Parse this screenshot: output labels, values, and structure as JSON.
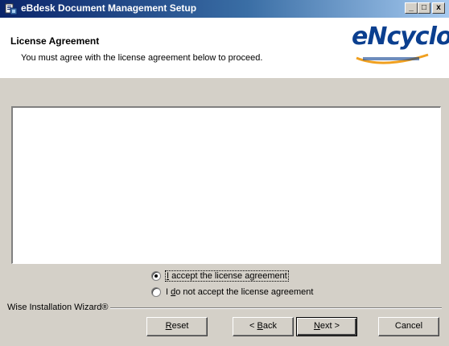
{
  "window": {
    "title": "eBdesk Document Management Setup",
    "controls": {
      "minimize": "_",
      "maximize": "□",
      "close": "x"
    }
  },
  "header": {
    "title": "License Agreement",
    "subtitle": "You must agree with the license agreement below to proceed.",
    "logo_text": "eNcyclo"
  },
  "license": {
    "text": ""
  },
  "options": {
    "accept": {
      "pre": "",
      "key": "I",
      "post": " accept the license agreement",
      "selected": true
    },
    "decline": {
      "pre": "I ",
      "key": "d",
      "post": "o not accept the license agreement",
      "selected": false
    }
  },
  "footer": {
    "brand": "Wise Installation Wizard®"
  },
  "buttons": {
    "reset": {
      "key": "R",
      "rest": "eset"
    },
    "back": {
      "pre": "< ",
      "key": "B",
      "rest": "ack"
    },
    "next": {
      "key": "N",
      "rest": "ext >"
    },
    "cancel": {
      "label": "Cancel"
    }
  },
  "colors": {
    "titlebar_start": "#0a246a",
    "titlebar_end": "#a6caf0",
    "face": "#d4d0c8",
    "logo_blue": "#0b3f8f",
    "logo_swoosh": "#f0a020"
  }
}
